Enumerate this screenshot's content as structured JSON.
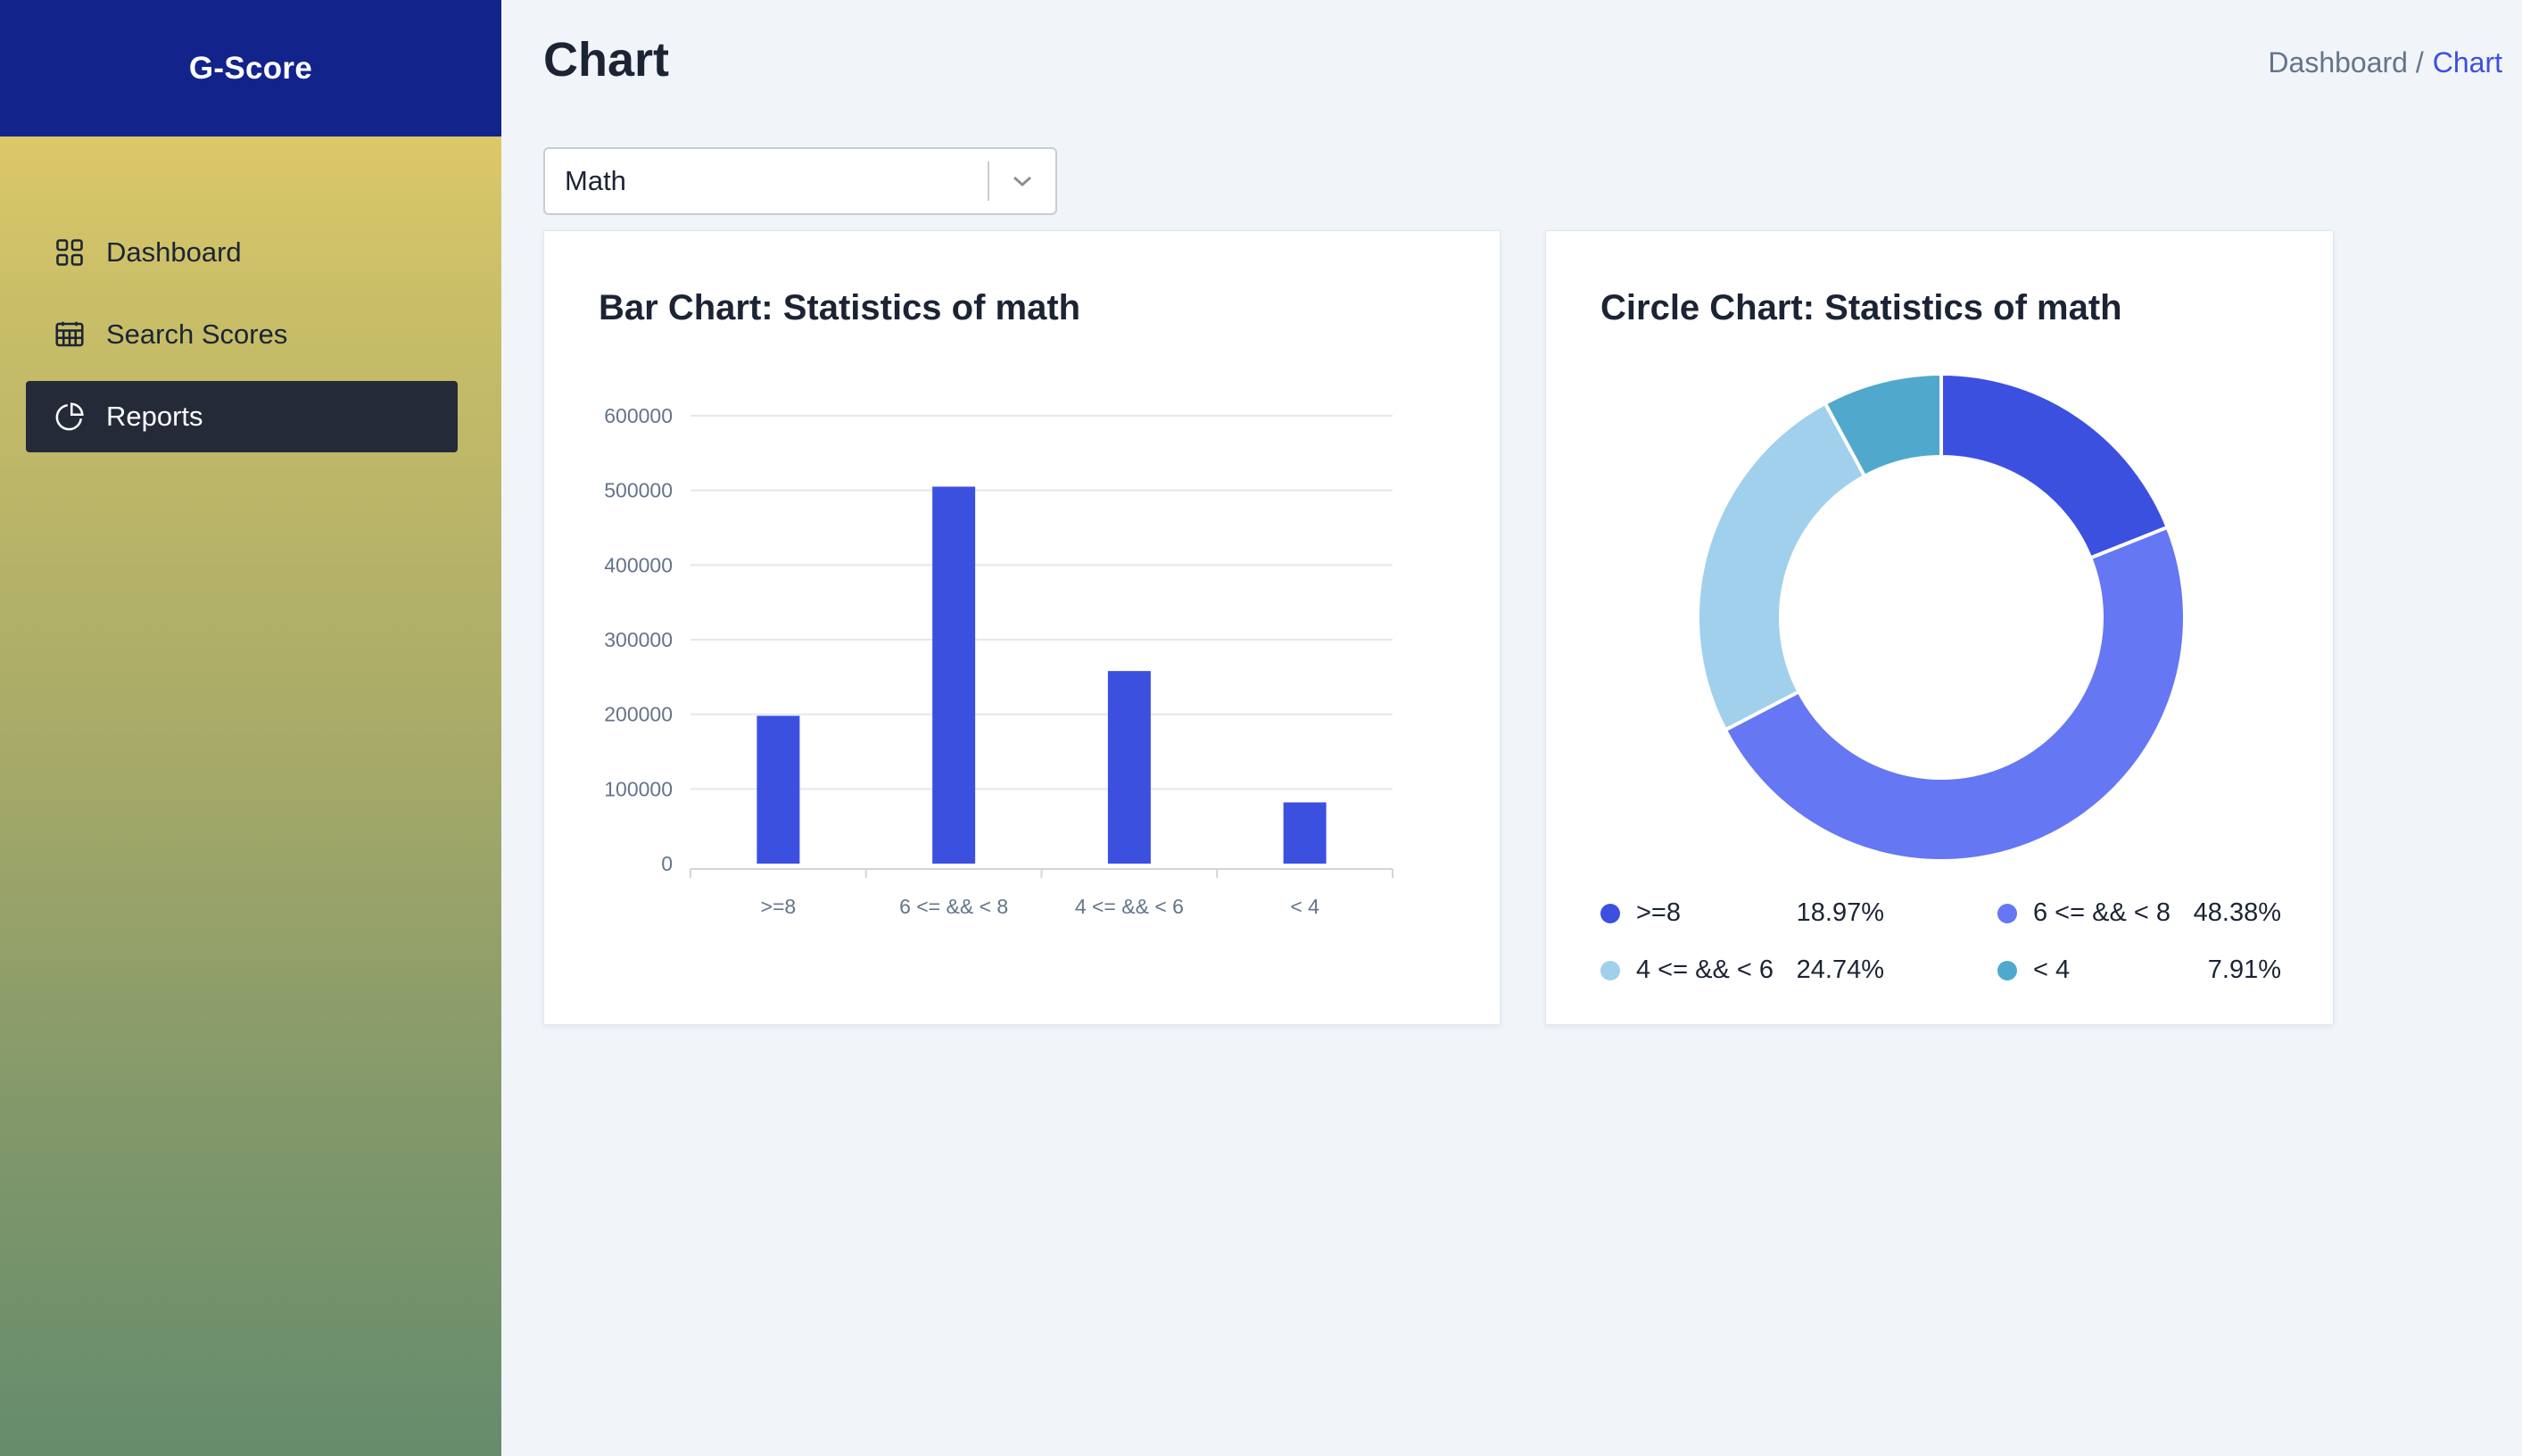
{
  "app": {
    "brand": "G-Score"
  },
  "sidebar": {
    "items": [
      {
        "label": "Dashboard",
        "icon": "grid-icon",
        "active": false
      },
      {
        "label": "Search Scores",
        "icon": "calendar-icon",
        "active": false
      },
      {
        "label": "Reports",
        "icon": "pie-chart-icon",
        "active": true
      }
    ]
  },
  "header": {
    "title": "Chart",
    "breadcrumb": {
      "parent": "Dashboard /",
      "current": "Chart"
    }
  },
  "filter": {
    "selected": "Math"
  },
  "colors": {
    "accent": "#3c50e0",
    "sidebar_top": "#13238c",
    "active_nav": "#242a38",
    "series": [
      "#3c50e0",
      "#6577f3",
      "#a0d0ec",
      "#50a9cd"
    ]
  },
  "chart_data": [
    {
      "type": "bar",
      "title": "Bar Chart: Statistics of math",
      "categories": [
        ">=8",
        "6 <= && < 8",
        "4 <= && < 6",
        "< 4"
      ],
      "values": [
        198000,
        505000,
        258000,
        82000
      ],
      "ylim": [
        0,
        600000
      ],
      "yticks": [
        "0",
        "100000",
        "200000",
        "300000",
        "400000",
        "500000",
        "600000"
      ],
      "grid": true
    },
    {
      "type": "pie",
      "title": "Circle Chart: Statistics of math",
      "labels": [
        ">=8",
        "6 <= && < 8",
        "4 <= && < 6",
        "< 4"
      ],
      "values": [
        18.97,
        48.38,
        24.74,
        7.91
      ],
      "percent_labels": [
        "18.97%",
        "48.38%",
        "24.74%",
        "7.91%"
      ],
      "donut": true,
      "legend_position": "bottom"
    }
  ]
}
